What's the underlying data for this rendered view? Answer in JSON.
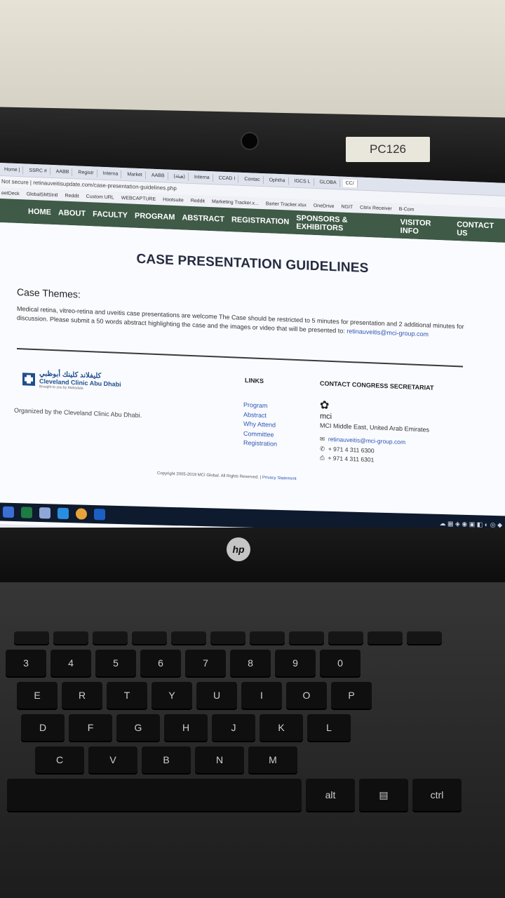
{
  "sticker": "PC126",
  "browser": {
    "tabs": [
      "Home |",
      "SSRC #",
      "AABB",
      "Registr",
      "Interna",
      "Market",
      "AABB",
      "(هيئة)",
      "Interna",
      "CCAD I",
      "Contac",
      "Ophtha",
      "IGCS L",
      "GLOBA",
      "CC/"
    ],
    "address": "Not secure | retinauveitisupdate.com/case-presentation-guidelines.php",
    "bookmarks": [
      "eetDeck",
      "GlobalSMSIntl",
      "Reddit",
      "Custom URL",
      "WEBCAPTURE",
      "Hootsuite",
      "Reddit",
      "Marketing Tracker.x...",
      "Barter Tracker.xlsx",
      "OneDrive",
      "NGIT",
      "Citrix Receiver",
      "B-Com"
    ]
  },
  "nav": [
    "HOME",
    "ABOUT",
    "FACULTY",
    "PROGRAM",
    "ABSTRACT",
    "REGISTRATION",
    "SPONSORS & EXHIBITORS",
    "VISITOR INFO",
    "CONTACT US"
  ],
  "page": {
    "title": "CASE PRESENTATION GUIDELINES",
    "themes_heading": "Case Themes:",
    "themes_text": "Medical retina, vitreo-retina and uveitis case presentations are welcome The Case should be restricted to 5 minutes for presentation and 2 additional minutes for discussion. Please submit a 50 words abstract highlighting the case and the images or video that will be presented to:",
    "themes_email": "retinauveitis@mci-group.com"
  },
  "footer": {
    "logo_ar": "كليفلاند كلينك أبوظبي",
    "logo_en": "Cleveland Clinic Abu Dhabi",
    "logo_tag": "Brought to you by Mubadala",
    "organized": "Organized by the Cleveland Clinic Abu Dhabi.",
    "links_heading": "LINKS",
    "links": [
      "Program",
      "Abstract",
      "Why Attend",
      "Committee",
      "Registration"
    ],
    "contact_heading": "CONTACT CONGRESS SECRETARIAT",
    "mci": "mci",
    "mci_location": "MCI Middle East, United Arab Emirates",
    "email": "retinauveitis@mci-group.com",
    "phone": "+ 971 4 311 6300",
    "fax": "+ 971 4 311 6301",
    "copyright": "Copyright 2005-2019 MCI Global. All Rights Reserved. |",
    "privacy": "Privacy Statement"
  },
  "laptop_brand": "hp",
  "keyboard": {
    "row1": [
      "3",
      "4",
      "5",
      "6",
      "7",
      "8",
      "9",
      "0"
    ],
    "row2": [
      "E",
      "R",
      "T",
      "Y",
      "U",
      "I",
      "O",
      "P"
    ],
    "row3": [
      "D",
      "F",
      "G",
      "H",
      "J",
      "K",
      "L"
    ],
    "row4": [
      "C",
      "V",
      "B",
      "N",
      "M"
    ],
    "alt": "alt",
    "ctrl": "ctrl"
  }
}
